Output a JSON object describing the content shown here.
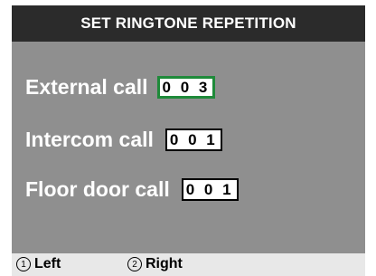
{
  "title": "SET RINGTONE REPETITION",
  "rows": [
    {
      "label": "External call",
      "value": "003",
      "selected": true
    },
    {
      "label": "Intercom call",
      "value": "001",
      "selected": false
    },
    {
      "label": "Floor door call",
      "value": "001",
      "selected": false
    }
  ],
  "footer": {
    "left_num": "1",
    "left_label": "Left",
    "right_num": "2",
    "right_label": "Right"
  },
  "colors": {
    "title_bg": "#2b2b2b",
    "screen_bg": "#8f8f8f",
    "selected_border": "#1f8a3a",
    "footer_bg": "#e8e8e8"
  }
}
